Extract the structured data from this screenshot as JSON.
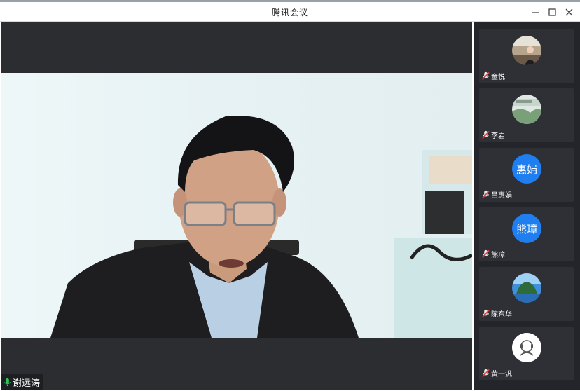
{
  "window": {
    "title": "腾讯会议",
    "minimize_icon": "minimize-icon",
    "maximize_icon": "maximize-icon",
    "close_icon": "close-icon"
  },
  "main_video": {
    "speaker_name": "谢远涛",
    "speaker_mic_icon": "mic-active-icon"
  },
  "participants": [
    {
      "name": "金悦",
      "avatar": "photo",
      "mic_icon": "mic-muted-icon"
    },
    {
      "name": "李岩",
      "avatar": "photo",
      "mic_icon": "mic-muted-icon"
    },
    {
      "name": "吕惠娟",
      "avatar_text": "惠娟",
      "mic_icon": "mic-muted-icon"
    },
    {
      "name": "熊璋",
      "avatar_text": "熊璋",
      "mic_icon": "mic-muted-icon"
    },
    {
      "name": "陈东华",
      "avatar": "photo",
      "mic_icon": "mic-muted-icon"
    },
    {
      "name": "黄一汎",
      "avatar": "default-person",
      "mic_icon": "mic-muted-icon"
    }
  ],
  "colors": {
    "avatar_blue": "#1f7ef0",
    "background_dark": "#2b2d31",
    "sidebar": "#23252a",
    "mic_active": "#2ec75a",
    "mic_muted": "#e03a3a"
  }
}
